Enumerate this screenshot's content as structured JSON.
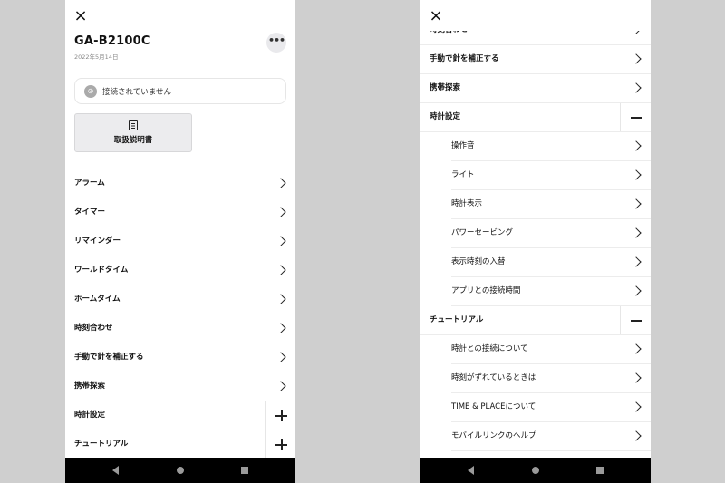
{
  "left": {
    "close_icon": "×",
    "device_name": "GA-B2100C",
    "date": "2022年5月14日",
    "more_icon": "•••",
    "status_text": "接続されていません",
    "status_icon": "⊘",
    "manual_label": "取扱説明書",
    "menu": [
      {
        "label": "アラーム",
        "action": "chevron"
      },
      {
        "label": "タイマー",
        "action": "chevron"
      },
      {
        "label": "リマインダー",
        "action": "chevron"
      },
      {
        "label": "ワールドタイム",
        "action": "chevron"
      },
      {
        "label": "ホームタイム",
        "action": "chevron"
      },
      {
        "label": "時刻合わせ",
        "action": "chevron"
      },
      {
        "label": "手動で針を補正する",
        "action": "chevron"
      },
      {
        "label": "携帯探索",
        "action": "chevron"
      },
      {
        "label": "時計設定",
        "action": "plus"
      },
      {
        "label": "チュートリアル",
        "action": "plus"
      }
    ]
  },
  "right": {
    "close_icon": "×",
    "partial_item": "時刻合わせ",
    "menu": [
      {
        "label": "手動で針を補正する",
        "action": "chevron",
        "sub": false
      },
      {
        "label": "携帯探索",
        "action": "chevron",
        "sub": false
      },
      {
        "label": "時計設定",
        "action": "minus",
        "sub": false
      },
      {
        "label": "操作音",
        "action": "chevron",
        "sub": true
      },
      {
        "label": "ライト",
        "action": "chevron",
        "sub": true
      },
      {
        "label": "時計表示",
        "action": "chevron",
        "sub": true
      },
      {
        "label": "パワーセービング",
        "action": "chevron",
        "sub": true
      },
      {
        "label": "表示時刻の入替",
        "action": "chevron",
        "sub": true
      },
      {
        "label": "アプリとの接続時間",
        "action": "chevron",
        "sub": true
      },
      {
        "label": "チュートリアル",
        "action": "minus",
        "sub": false
      },
      {
        "label": "時計との接続について",
        "action": "chevron",
        "sub": true
      },
      {
        "label": "時刻がずれているときは",
        "action": "chevron",
        "sub": true
      },
      {
        "label": "TIME & PLACEについて",
        "action": "chevron",
        "sub": true
      },
      {
        "label": "モバイルリンクのヘルプ",
        "action": "chevron",
        "sub": true
      }
    ]
  }
}
